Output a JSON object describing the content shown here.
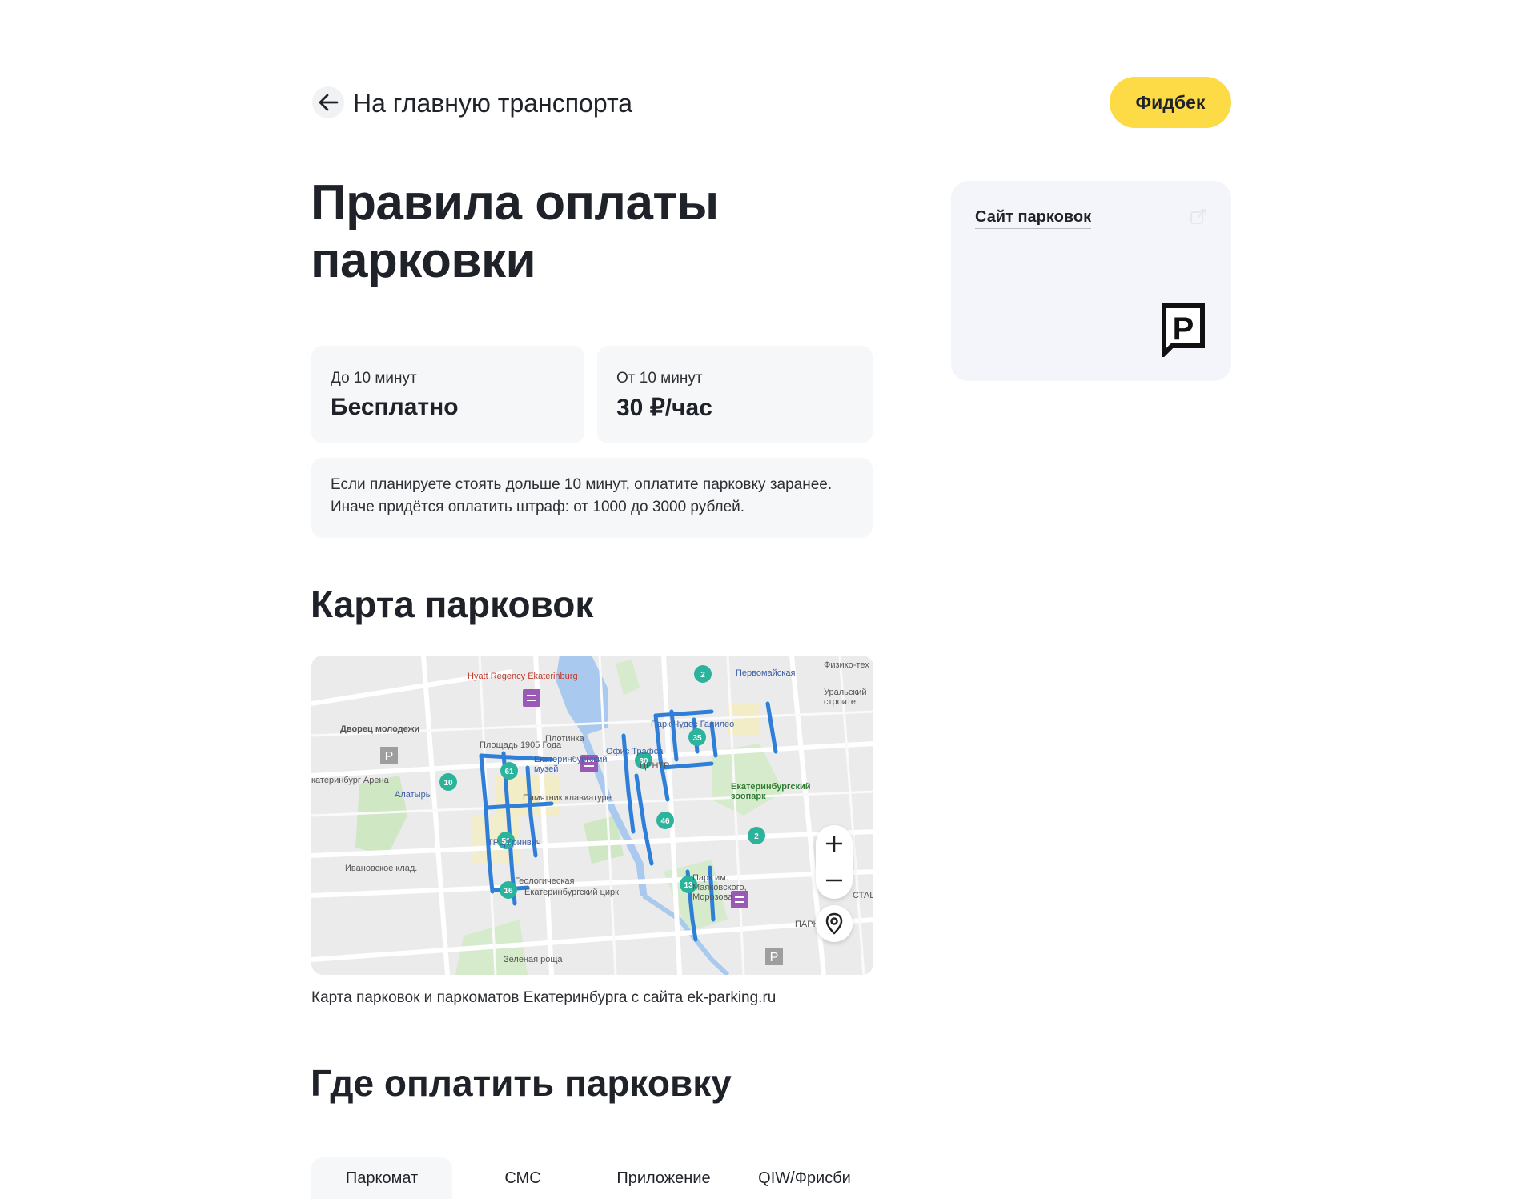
{
  "header": {
    "back_label": "На главную транспорта",
    "feedback_label": "Фидбек"
  },
  "page_title": "Правила оплаты парковки",
  "tariffs": [
    {
      "condition": "До 10 минут",
      "price": "Бесплатно"
    },
    {
      "condition": "От 10 минут",
      "price": "30 ₽/час"
    }
  ],
  "notice": "Если планируете стоять дольше 10 минут, оплатите парковку заранее. Иначе придётся оплатить штраф: от 1000 до 3000 рублей.",
  "side_card": {
    "link_label": "Сайт парковок",
    "icons": [
      "external-link-icon",
      "parking-sign-icon"
    ]
  },
  "map_section": {
    "title": "Карта парковок",
    "caption": "Карта парковок и паркоматов Екатеринбурга с сайта ek-parking.ru",
    "labels": {
      "hyatt": "Hyatt Regency Ekaterinburg",
      "pervomayskaya": "Первомайская",
      "fiziko": "Физико-тех",
      "uralsky": "Уральский строите",
      "dvorets": "Дворец молодежи",
      "plotinka": "Плотинка",
      "ploshad": "Площадь 1905 Года",
      "park": "Парк Чудес Галилео",
      "ekb_museum": "Екатеринбургский музей",
      "ofis": "Офис Трафса",
      "centr": "ЦЕНТР",
      "arena": "катеринбург Арена",
      "altair": "Алатырь",
      "pamyatnik": "Памятник клавиатуре",
      "zoo": "Екатеринбургский зоопарк",
      "trc": "ТРЦ Гринвич",
      "ivanovskoe": "Ивановское клад.",
      "circus": "Екатеринбургский цирк",
      "geolog": "Геологическая",
      "park_mayakovsky": "Парк им. Маяковского, Морозова",
      "zelenaya": "Зеленая роща",
      "park_small": "ПАРК",
      "stations": "СТАЦ"
    },
    "clusters": [
      "2",
      "35",
      "30",
      "61",
      "10",
      "46",
      "2",
      "51",
      "16",
      "13"
    ],
    "controls": {
      "zoom_in": "+",
      "zoom_out": "−"
    }
  },
  "payment_section": {
    "title": "Где оплатить парковку",
    "tabs": [
      "Паркомат",
      "СМС",
      "Приложение",
      "QIW/Фрисби"
    ],
    "active_tab": "Паркомат"
  },
  "colors": {
    "accent_yellow": "#fcdb46",
    "card_bg": "#f6f7f8",
    "cluster_green": "#2bb39b",
    "route_blue": "#2f7fd8",
    "marker_purple": "#9b59b6"
  }
}
